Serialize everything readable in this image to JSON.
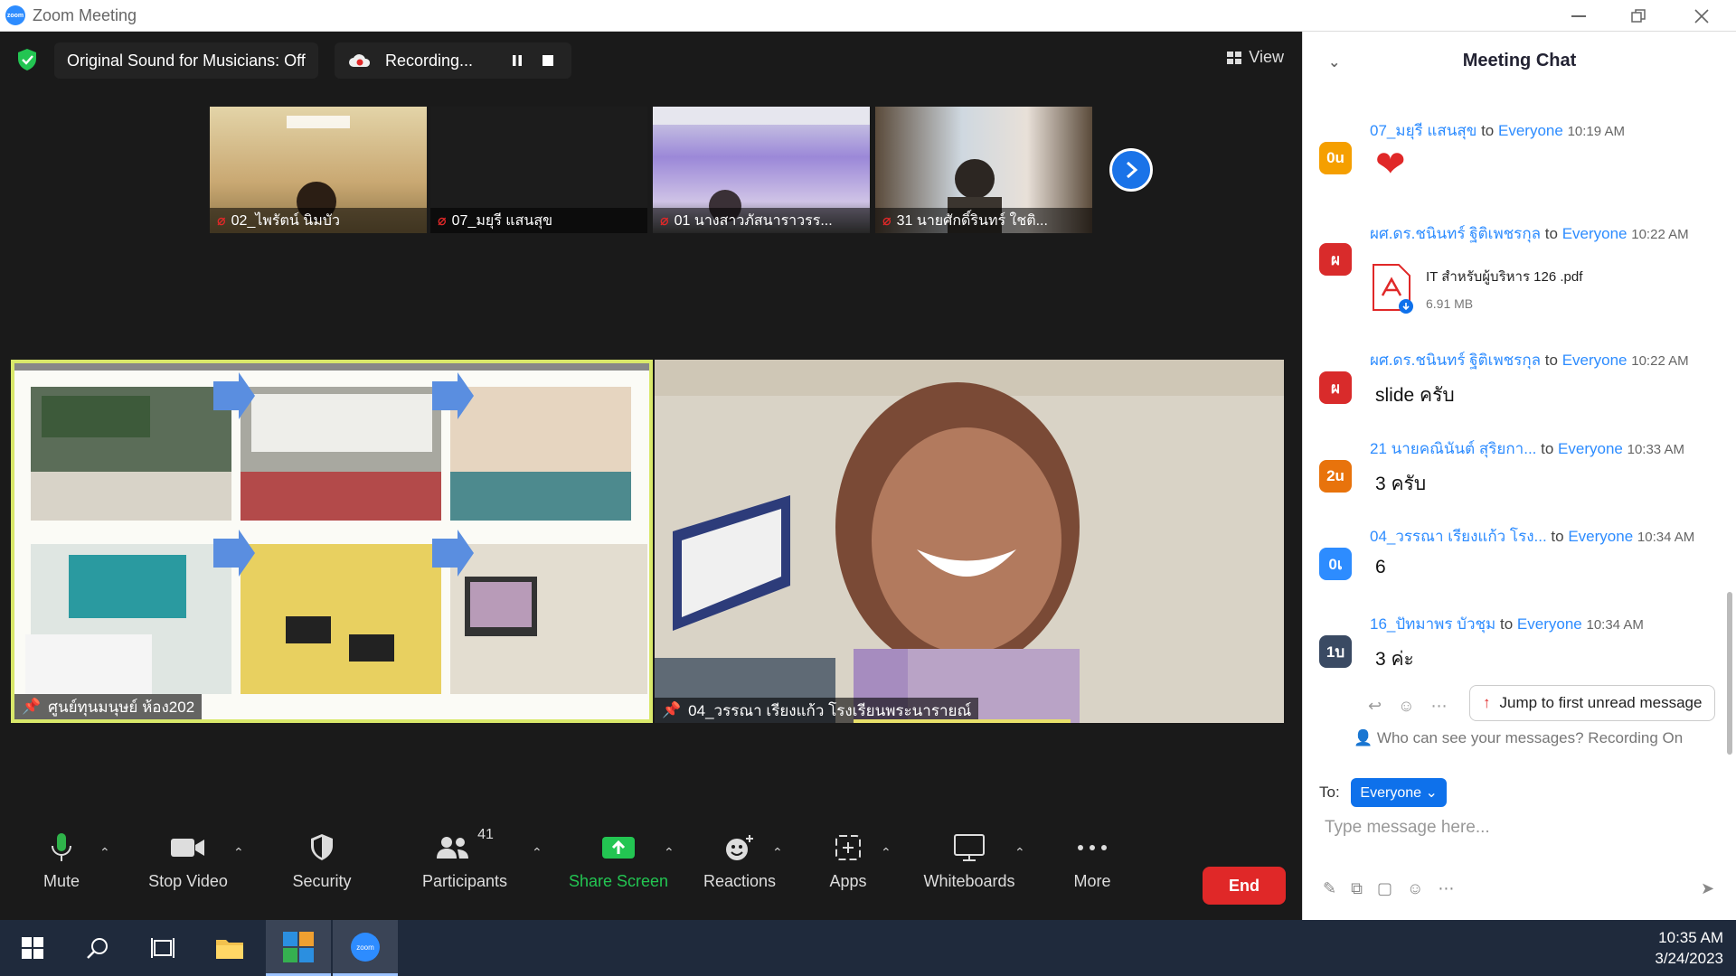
{
  "window": {
    "title": "Zoom Meeting",
    "logo_text": "zoom"
  },
  "topbar": {
    "sound_label": "Original Sound for Musicians: Off",
    "recording_label": "Recording...",
    "view_label": "View"
  },
  "strip_tiles": [
    {
      "name": "02_ไพรัตน์ นิมบัว"
    },
    {
      "name": "07_มยุรี แสนสุข"
    },
    {
      "name": "01 นางสาวภัสนาราวรร..."
    },
    {
      "name": "31 นายศักดิ์รินทร์ ใชติ..."
    }
  ],
  "main_tiles": {
    "left_name": "ศูนย์ทุนมนุษย์ ห้อง202",
    "right_name": "04_วรรณา เรียงแก้ว โรงเรียนพระนารายณ์"
  },
  "toolbar": {
    "mute": "Mute",
    "stop_video": "Stop Video",
    "security": "Security",
    "participants": "Participants",
    "participants_count": "41",
    "share_screen": "Share Screen",
    "reactions": "Reactions",
    "apps": "Apps",
    "whiteboards": "Whiteboards",
    "more": "More",
    "end": "End"
  },
  "chat": {
    "title": "Meeting Chat",
    "to_word": "to",
    "everyone": "Everyone",
    "messages": [
      {
        "avatar": "0u",
        "avatar_color": "#f59f00",
        "sender": "07_มยุรี แสนสุข",
        "time": "10:19 AM",
        "body": "❤"
      },
      {
        "avatar": "ผ",
        "avatar_color": "#d92b2b",
        "sender": "ผศ.ดร.ชนินทร์ ฐิติเพชรกุล",
        "time": "10:22 AM",
        "file_name": "IT สำหรับผู้บริหาร 126 .pdf",
        "file_size": "6.91 MB"
      },
      {
        "avatar": "ผ",
        "avatar_color": "#d92b2b",
        "sender": "ผศ.ดร.ชนินทร์ ฐิติเพชรกุล",
        "time": "10:22 AM",
        "body": "slide ครับ"
      },
      {
        "avatar": "2u",
        "avatar_color": "#e8730c",
        "sender": "21 นายคณินันต์ สุริยกา...",
        "time": "10:33 AM",
        "body": "3 ครับ"
      },
      {
        "avatar": "0เ",
        "avatar_color": "#2d8cff",
        "sender": "04_วรรณา เรียงแก้ว โรง...",
        "time": "10:34 AM",
        "body": "6"
      },
      {
        "avatar": "1บ",
        "avatar_color": "#3a4a63",
        "sender": "16_ปัทมาพร บัวชุม",
        "time": "10:34 AM",
        "body": "3 ค่ะ"
      }
    ],
    "jump_label": "Jump to first unread message",
    "privacy_note": "Who can see your messages? Recording On",
    "to_label": "To:",
    "to_value": "Everyone",
    "input_placeholder": "Type message here..."
  },
  "taskbar": {
    "time": "10:35 AM",
    "date": "3/24/2023"
  }
}
